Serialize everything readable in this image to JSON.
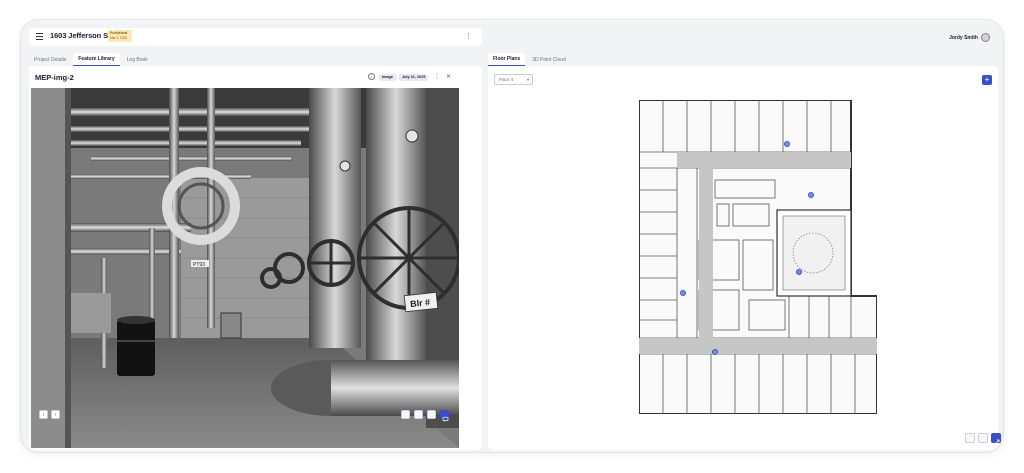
{
  "header": {
    "title": "1603 Jefferson St.",
    "badge": {
      "status": "Published",
      "date": "Mar 2, 2025"
    }
  },
  "left_tabs": [
    "Project Details",
    "Feature Library",
    "Log Book"
  ],
  "left_active_tab": "Feature Library",
  "feature": {
    "title": "MEP-img-2",
    "type_chip": "Image",
    "date_chip": "July 21, 2025"
  },
  "photo_sign": "Blr #",
  "photo_tag": "PT93",
  "nav": {
    "prev": "‹",
    "next": "›"
  },
  "user": {
    "name": "Jordy Smith"
  },
  "right_tabs": [
    "Floor Plans",
    "3D Point Cloud"
  ],
  "right_active_tab": "Floor Plans",
  "floor_select": {
    "value": "Floor 4"
  },
  "icons": {
    "menu": "hamburger-icon",
    "info": "info-icon",
    "add": "plus-icon",
    "comment": "comment-icon"
  },
  "colors": {
    "accent": "#3b4ec8",
    "badge_bg": "#fde9b8",
    "chip_bg": "#e6e8f5"
  }
}
